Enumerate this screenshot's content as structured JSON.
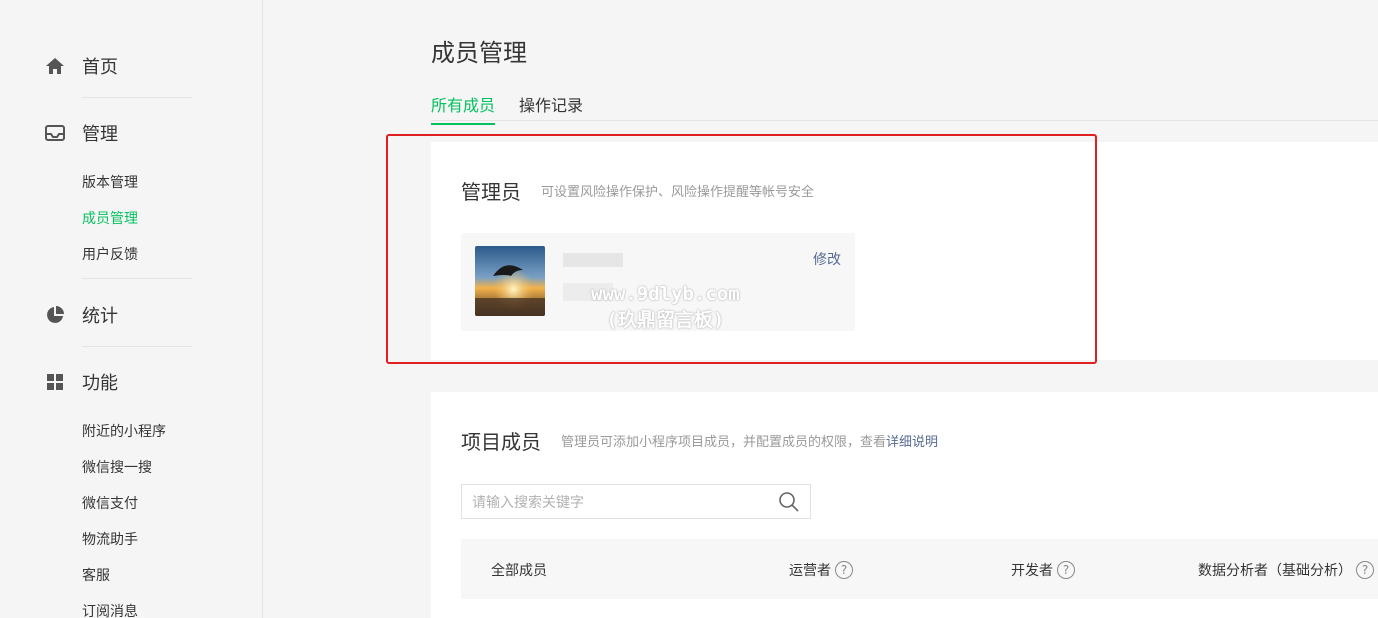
{
  "sidebar": {
    "home": "首页",
    "manage": "管理",
    "manage_items": [
      "版本管理",
      "成员管理",
      "用户反馈"
    ],
    "stats": "统计",
    "features": "功能",
    "feature_items": [
      "附近的小程序",
      "微信搜一搜",
      "微信支付",
      "物流助手",
      "客服",
      "订阅消息"
    ],
    "active_item": "成员管理"
  },
  "page": {
    "title": "成员管理",
    "tabs": [
      "所有成员",
      "操作记录"
    ],
    "active_tab": "所有成员"
  },
  "admin_card": {
    "title": "管理员",
    "description": "可设置风险操作保护、风险操作提醒等帐号安全",
    "modify_label": "修改",
    "watermark_line1": "www.9dlyb.com",
    "watermark_line2": "(玖鼎留言板)"
  },
  "members_card": {
    "title": "项目成员",
    "description": "管理员可添加小程序项目成员，并配置成员的权限，查看",
    "description_link": "详细说明",
    "search_placeholder": "请输入搜索关键字",
    "columns": [
      "全部成员",
      "运营者",
      "开发者",
      "数据分析者（基础分析）"
    ],
    "help_glyph": "?"
  },
  "colors": {
    "accent": "#07c160",
    "link": "#576b95",
    "highlight": "#e02020"
  }
}
